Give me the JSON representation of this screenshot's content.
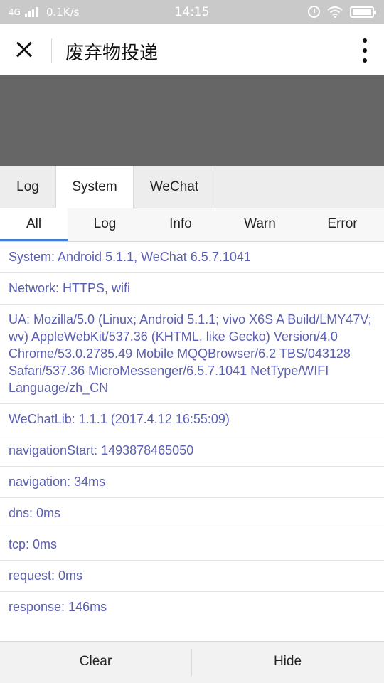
{
  "status_bar": {
    "network_type": "4G",
    "speed": "0.1K/s",
    "time": "14:15"
  },
  "header": {
    "title": "废弃物投递"
  },
  "main_tabs": [
    "Log",
    "System",
    "WeChat"
  ],
  "active_main_tab": "System",
  "sub_tabs": [
    "All",
    "Log",
    "Info",
    "Warn",
    "Error"
  ],
  "active_sub_tab": "All",
  "log_lines": [
    "System: Android 5.1.1, WeChat 6.5.7.1041",
    "Network: HTTPS, wifi",
    "UA: Mozilla/5.0 (Linux; Android 5.1.1; vivo X6S A Build/LMY47V; wv) AppleWebKit/537.36 (KHTML, like Gecko) Version/4.0 Chrome/53.0.2785.49 Mobile MQQBrowser/6.2 TBS/043128 Safari/537.36 MicroMessenger/6.5.7.1041 NetType/WIFI Language/zh_CN",
    "WeChatLib: 1.1.1 (2017.4.12 16:55:09)",
    "navigationStart: 1493878465050",
    "navigation: 34ms",
    "dns: 0ms",
    "tcp: 0ms",
    "request: 0ms",
    "response: 146ms"
  ],
  "footer": {
    "clear_label": "Clear",
    "hide_label": "Hide"
  },
  "colors": {
    "log_text": "#5b5fb0",
    "active_tab_underline": "#3e7dcf",
    "overlay": "#666666"
  }
}
